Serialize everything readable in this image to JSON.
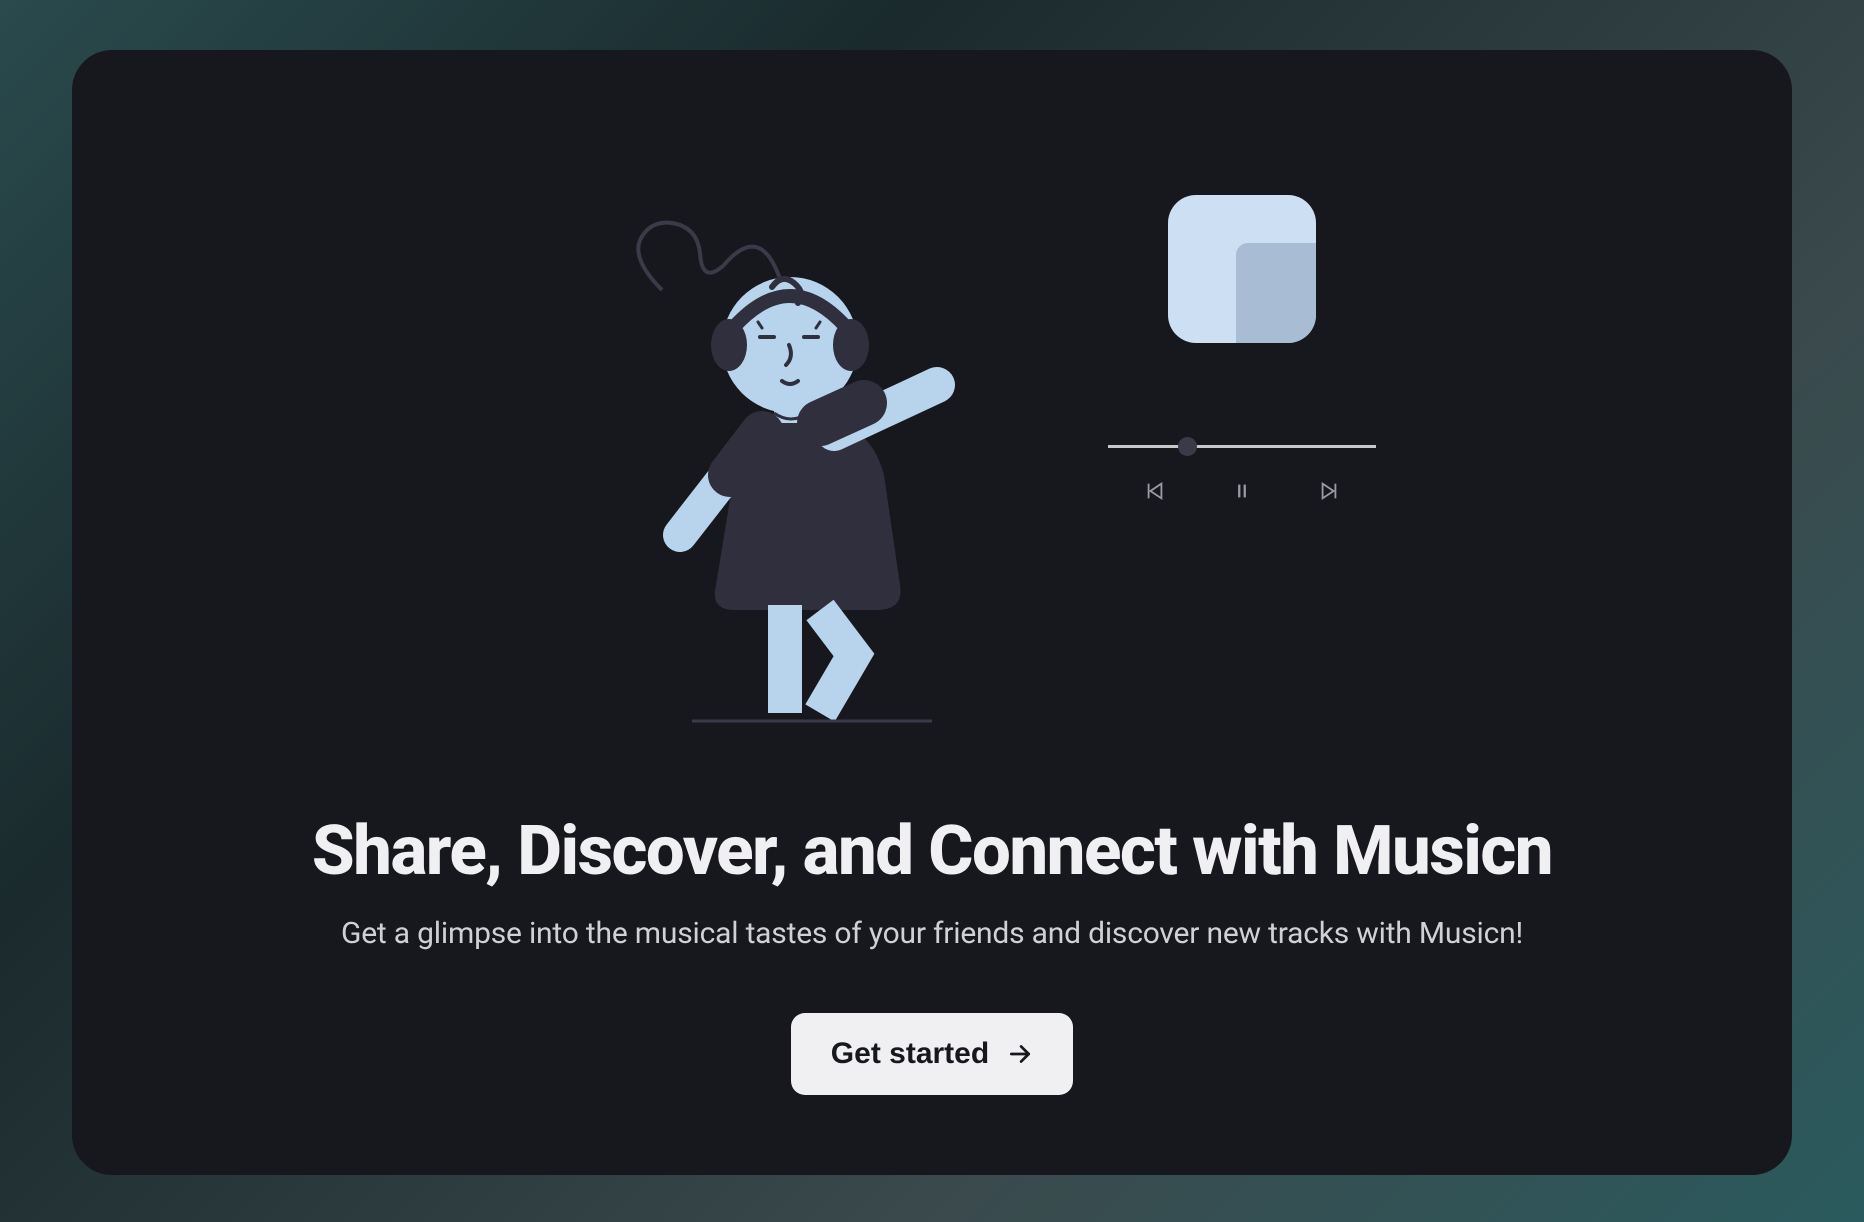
{
  "hero": {
    "headline": "Share, Discover, and Connect with Musicn",
    "subheadline": "Get a glimpse into the musical tastes of your friends and discover new tracks with Musicn!",
    "cta_label": "Get started"
  },
  "player": {
    "progress_percent": 26
  },
  "colors": {
    "card_bg": "#16181d",
    "text_primary": "#f0f0f2",
    "text_secondary": "#d0d0d5",
    "album_bg": "#cde0f3",
    "album_inner": "#a8bcd4",
    "person_skin": "#b8d4ec",
    "person_dark": "#302f3d"
  }
}
